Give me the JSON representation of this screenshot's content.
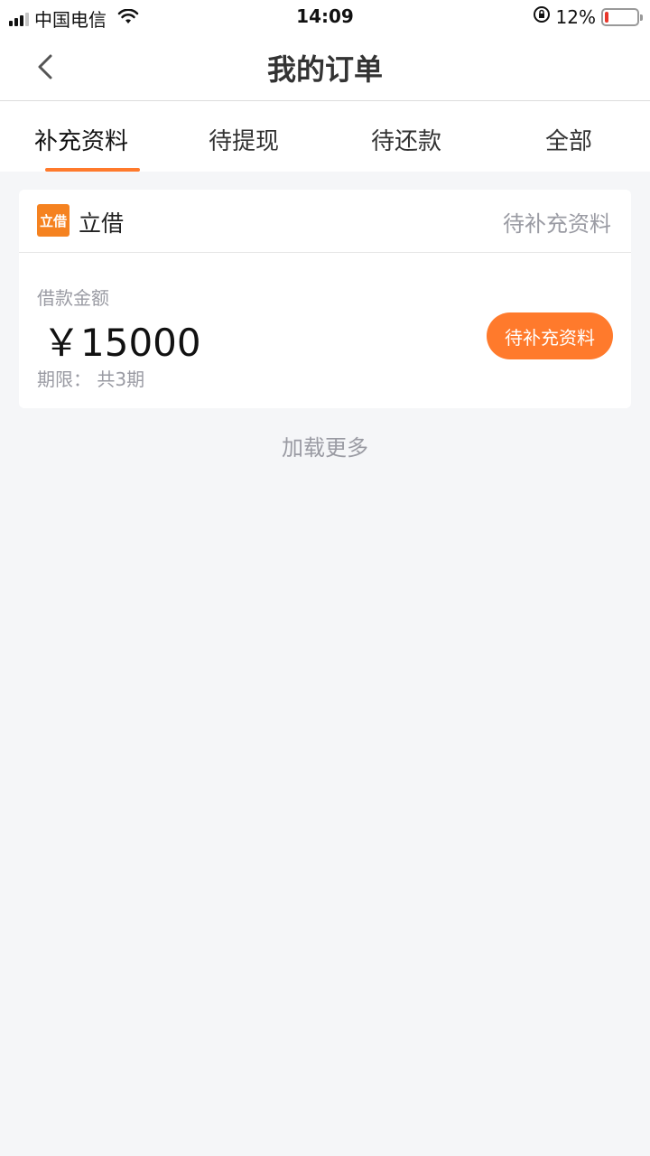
{
  "status_bar": {
    "carrier": "中国电信",
    "time": "14:09",
    "battery_percent": "12%",
    "battery_level": 0.12,
    "battery_color": "#e8372b"
  },
  "nav": {
    "title": "我的订单",
    "back_icon": "chevron-left-icon"
  },
  "tabs": [
    {
      "label": "补充资料",
      "active": true
    },
    {
      "label": "待提现",
      "active": false
    },
    {
      "label": "待还款",
      "active": false
    },
    {
      "label": "全部",
      "active": false
    }
  ],
  "order": {
    "logo_text": "立借",
    "brand_name": "立借",
    "status": "待补充资料",
    "amount_label": "借款金额",
    "amount": "￥15000",
    "term": "期限：  共3期",
    "action_label": "待补充资料"
  },
  "load_more": "加载更多",
  "colors": {
    "accent": "#ff7a2c",
    "muted_text": "#9a9ba3",
    "background": "#f5f6f8"
  }
}
